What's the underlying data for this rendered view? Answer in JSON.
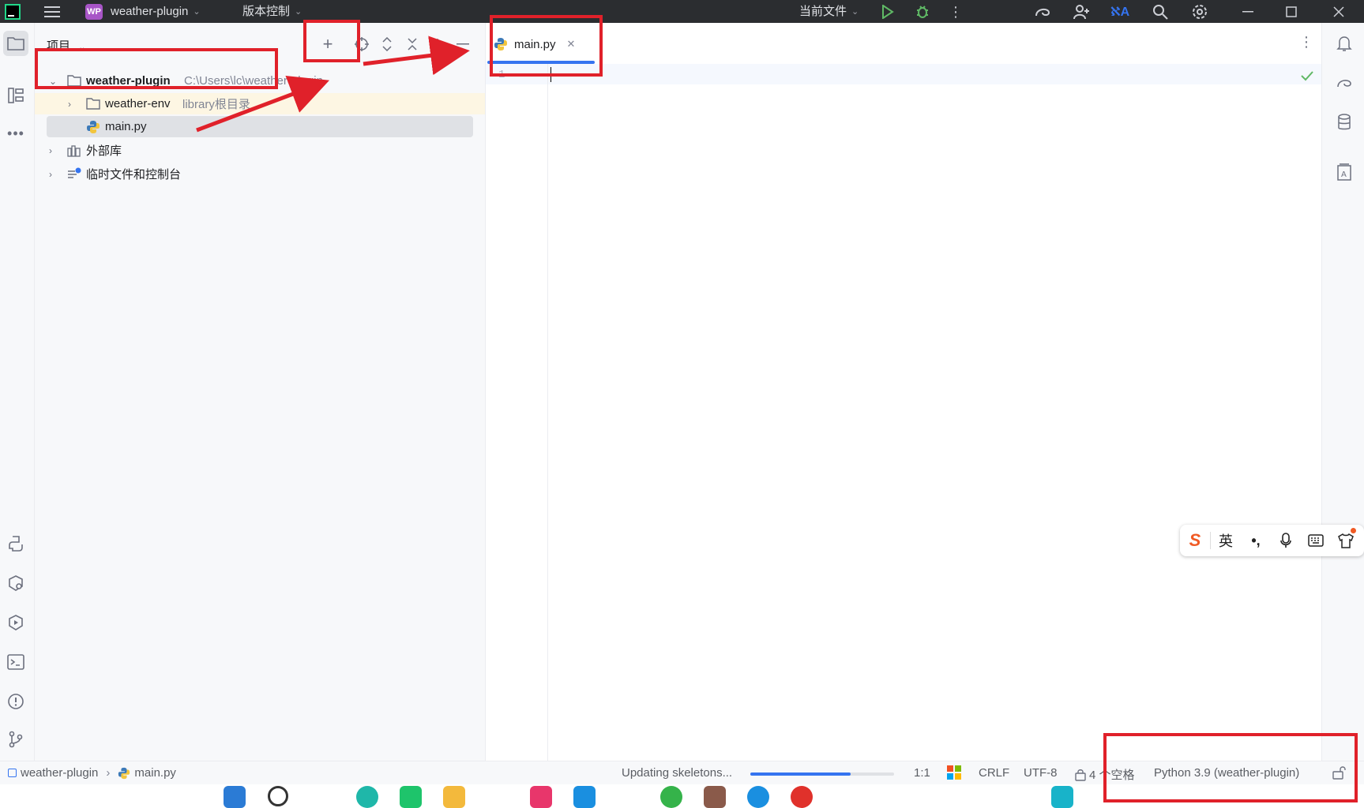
{
  "titlebar": {
    "project_badge": "WP",
    "project_name": "weather-plugin",
    "vcs_menu": "版本控制",
    "run_config": "当前文件"
  },
  "project_panel": {
    "title": "项目",
    "tree": {
      "root_name": "weather-plugin",
      "root_path": "C:\\Users\\lc\\weather-plugin",
      "env_name": "weather-env",
      "env_note": "library根目录",
      "file_name": "main.py",
      "external_libs": "外部库",
      "scratches": "临时文件和控制台"
    }
  },
  "editor": {
    "tab_label": "main.py",
    "line_number": "1"
  },
  "ime": {
    "logo": "S",
    "mode": "英",
    "punct": "•,"
  },
  "statusbar": {
    "breadcrumb_project": "weather-plugin",
    "breadcrumb_file": "main.py",
    "task": "Updating skeletons...",
    "progress": 0.7,
    "caret_pos": "1:1",
    "line_sep": "CRLF",
    "encoding": "UTF-8",
    "indent": "4 个空格",
    "interpreter": "Python 3.9 (weather-plugin)"
  },
  "colors": {
    "accent": "#3574f0",
    "annotation": "#e0212a",
    "titlebar_bg": "#2b2d30",
    "highlight_row": "#fdf6e3"
  }
}
